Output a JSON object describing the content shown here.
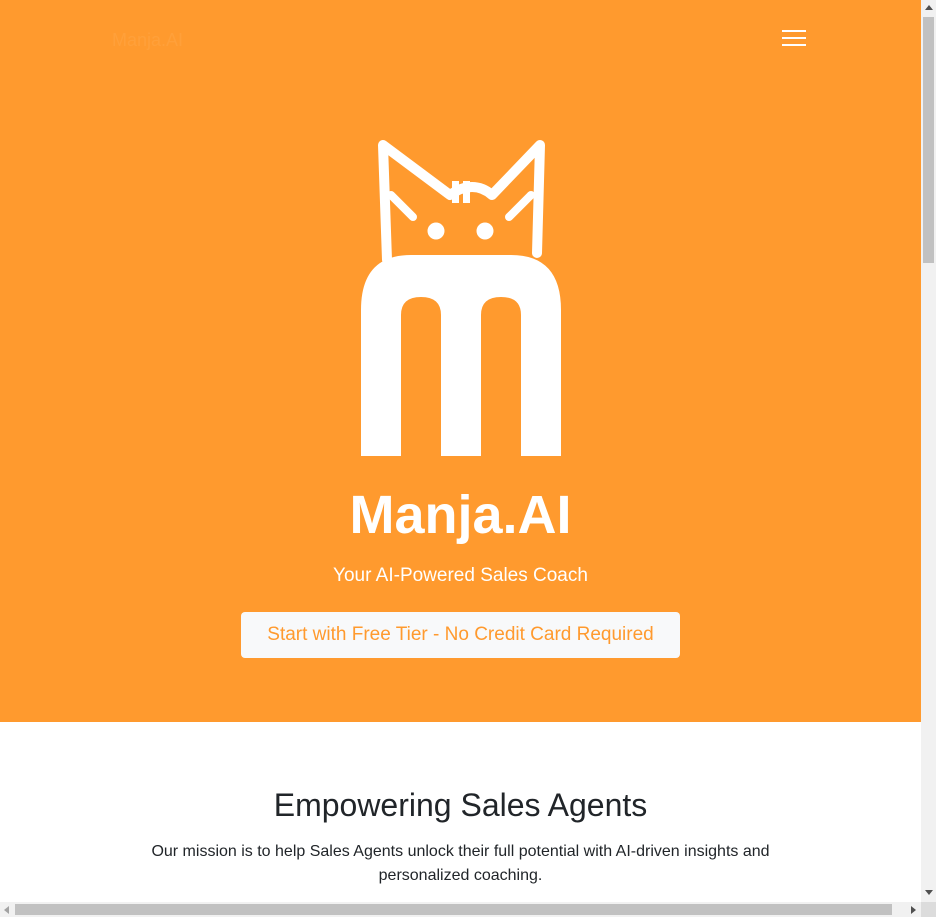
{
  "navbar": {
    "brand": "Manja.AI",
    "menu_toggle_icon": "hamburger-icon"
  },
  "hero": {
    "logo_icon": "manja-cat-logo",
    "title": "Manja.AI",
    "subtitle": "Your AI-Powered Sales Coach",
    "cta_label": "Start with Free Tier - No Credit Card Required"
  },
  "mission": {
    "title": "Empowering Sales Agents",
    "text": "Our mission is to help Sales Agents unlock their full potential with AI-driven insights and personalized coaching."
  },
  "colors": {
    "brand_orange": "#ff9a2e",
    "cta_background": "#f8f9fa",
    "text_dark": "#212529",
    "white": "#ffffff"
  }
}
